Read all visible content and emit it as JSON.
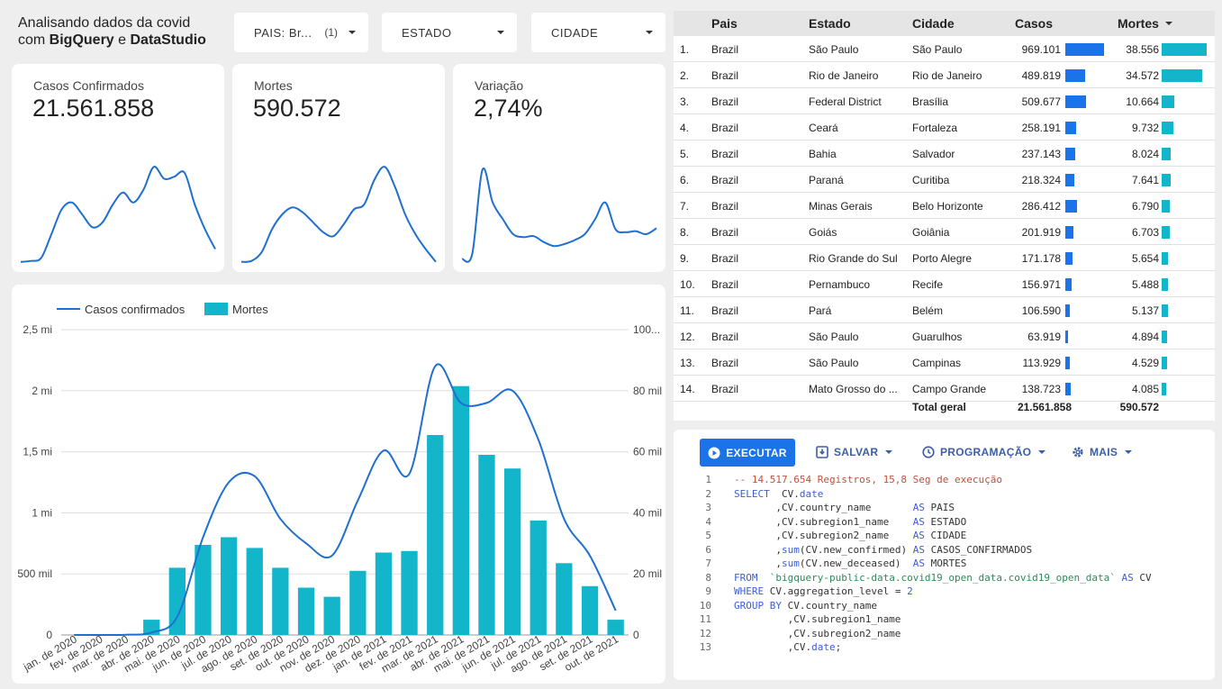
{
  "header": {
    "title_line1": "Analisando dados da covid",
    "title_prefix": "com ",
    "title_bigquery": "BigQuery",
    "title_e": " e ",
    "title_datastudio": "DataStudio"
  },
  "filters": [
    {
      "label": "PAIS: Br...",
      "count": "(1)"
    },
    {
      "label": "ESTADO",
      "count": ""
    },
    {
      "label": "CIDADE",
      "count": ""
    }
  ],
  "kpis": [
    {
      "label": "Casos Confirmados",
      "value": "21.561.858"
    },
    {
      "label": "Mortes",
      "value": "590.572"
    },
    {
      "label": "Variação",
      "value": "2,74%"
    }
  ],
  "colors": {
    "line": "#1f6fd1",
    "bar": "#12b5c9",
    "bar_cases": "#1a73e8",
    "bar_deaths": "#12b5c9"
  },
  "sparklines": [
    [
      0.02,
      0.03,
      0.06,
      0.3,
      0.55,
      0.62,
      0.5,
      0.37,
      0.42,
      0.6,
      0.72,
      0.62,
      0.75,
      0.98,
      0.86,
      0.88,
      0.92,
      0.6,
      0.35,
      0.15
    ],
    [
      0.02,
      0.03,
      0.12,
      0.35,
      0.5,
      0.57,
      0.52,
      0.42,
      0.32,
      0.28,
      0.4,
      0.55,
      0.6,
      0.85,
      0.98,
      0.78,
      0.5,
      0.3,
      0.15,
      0.02
    ],
    [
      0.05,
      0.1,
      0.95,
      0.62,
      0.45,
      0.3,
      0.27,
      0.28,
      0.22,
      0.18,
      0.2,
      0.24,
      0.3,
      0.45,
      0.62,
      0.35,
      0.32,
      0.33,
      0.3,
      0.36
    ]
  ],
  "chart_data": {
    "type": "bar",
    "legend": [
      "Casos confirmados",
      "Mortes"
    ],
    "legend_position": "top-left",
    "categories": [
      "jan. de 2020",
      "fev. de 2020",
      "mar. de 2020",
      "abr. de 2020",
      "mai. de 2020",
      "jun. de 2020",
      "jul. de 2020",
      "ago. de 2020",
      "set. de 2020",
      "out. de 2020",
      "nov. de 2020",
      "dez. de 2020",
      "jan. de 2021",
      "fev. de 2021",
      "mar. de 2021",
      "abr. de 2021",
      "mai. de 2021",
      "jun. de 2021",
      "jul. de 2021",
      "ago. de 2021",
      "set. de 2021",
      "out. de 2021"
    ],
    "series": [
      {
        "name": "Casos confirmados",
        "type": "line",
        "axis": "left",
        "values": [
          0,
          0,
          2000,
          20000,
          150000,
          800000,
          1250000,
          1300000,
          950000,
          750000,
          650000,
          1100000,
          1510000,
          1320000,
          2200000,
          1900000,
          1900000,
          2000000,
          1600000,
          950000,
          650000,
          200000
        ]
      },
      {
        "name": "Mortes",
        "type": "bar",
        "axis": "right",
        "values": [
          0,
          0,
          100,
          5000,
          22000,
          29500,
          32000,
          28500,
          22000,
          15500,
          12500,
          21000,
          27000,
          27500,
          65500,
          81500,
          59000,
          54500,
          37500,
          23500,
          16000,
          5000
        ]
      }
    ],
    "y_left": {
      "ticks": [
        "0",
        "500 mil",
        "1 mi",
        "1,5 mi",
        "2 mi",
        "2,5 mi"
      ],
      "range": [
        0,
        2500000
      ]
    },
    "y_right": {
      "ticks": [
        "0",
        "20 mil",
        "40 mil",
        "60 mil",
        "80 mil",
        "100..."
      ],
      "range": [
        0,
        100000
      ]
    },
    "grid": true
  },
  "table": {
    "headers": [
      "Pais",
      "Estado",
      "Cidade",
      "Casos",
      "Mortes"
    ],
    "sort_icon": "sort-desc-icon",
    "rows": [
      {
        "idx": "1.",
        "pais": "Brazil",
        "estado": "São Paulo",
        "cidade": "São Paulo",
        "casos": "969.101",
        "casos_n": 969101,
        "mortes": "38.556",
        "mortes_n": 38556
      },
      {
        "idx": "2.",
        "pais": "Brazil",
        "estado": "Rio de Janeiro",
        "cidade": "Rio de Janeiro",
        "casos": "489.819",
        "casos_n": 489819,
        "mortes": "34.572",
        "mortes_n": 34572
      },
      {
        "idx": "3.",
        "pais": "Brazil",
        "estado": "Federal District",
        "cidade": "Brasília",
        "casos": "509.677",
        "casos_n": 509677,
        "mortes": "10.664",
        "mortes_n": 10664
      },
      {
        "idx": "4.",
        "pais": "Brazil",
        "estado": "Ceará",
        "cidade": "Fortaleza",
        "casos": "258.191",
        "casos_n": 258191,
        "mortes": "9.732",
        "mortes_n": 9732
      },
      {
        "idx": "5.",
        "pais": "Brazil",
        "estado": "Bahia",
        "cidade": "Salvador",
        "casos": "237.143",
        "casos_n": 237143,
        "mortes": "8.024",
        "mortes_n": 8024
      },
      {
        "idx": "6.",
        "pais": "Brazil",
        "estado": "Paraná",
        "cidade": "Curitiba",
        "casos": "218.324",
        "casos_n": 218324,
        "mortes": "7.641",
        "mortes_n": 7641
      },
      {
        "idx": "7.",
        "pais": "Brazil",
        "estado": "Minas Gerais",
        "cidade": "Belo Horizonte",
        "casos": "286.412",
        "casos_n": 286412,
        "mortes": "6.790",
        "mortes_n": 6790
      },
      {
        "idx": "8.",
        "pais": "Brazil",
        "estado": "Goiás",
        "cidade": "Goiânia",
        "casos": "201.919",
        "casos_n": 201919,
        "mortes": "6.703",
        "mortes_n": 6703
      },
      {
        "idx": "9.",
        "pais": "Brazil",
        "estado": "Rio Grande do Sul",
        "cidade": "Porto Alegre",
        "casos": "171.178",
        "casos_n": 171178,
        "mortes": "5.654",
        "mortes_n": 5654
      },
      {
        "idx": "10.",
        "pais": "Brazil",
        "estado": "Pernambuco",
        "cidade": "Recife",
        "casos": "156.971",
        "casos_n": 156971,
        "mortes": "5.488",
        "mortes_n": 5488
      },
      {
        "idx": "11.",
        "pais": "Brazil",
        "estado": "Pará",
        "cidade": "Belém",
        "casos": "106.590",
        "casos_n": 106590,
        "mortes": "5.137",
        "mortes_n": 5137
      },
      {
        "idx": "12.",
        "pais": "Brazil",
        "estado": "São Paulo",
        "cidade": "Guarulhos",
        "casos": "63.919",
        "casos_n": 63919,
        "mortes": "4.894",
        "mortes_n": 4894
      },
      {
        "idx": "13.",
        "pais": "Brazil",
        "estado": "São Paulo",
        "cidade": "Campinas",
        "casos": "113.929",
        "casos_n": 113929,
        "mortes": "4.529",
        "mortes_n": 4529
      },
      {
        "idx": "14.",
        "pais": "Brazil",
        "estado": "Mato Grosso do ...",
        "cidade": "Campo Grande",
        "casos": "138.723",
        "casos_n": 138723,
        "mortes": "4.085",
        "mortes_n": 4085
      }
    ],
    "total_label": "Total geral",
    "total_casos": "21.561.858",
    "total_mortes": "590.572"
  },
  "sql_toolbar": {
    "run": "EXECUTAR",
    "save": "SALVAR",
    "schedule": "PROGRAMAÇÃO",
    "more": "MAIS"
  },
  "sql_lines": [
    {
      "n": "1",
      "html": "<span class=\"cm\">-- 14.517.654 Registros, 15,8 Seg de execução</span>"
    },
    {
      "n": "2",
      "html": "<span class=\"kw\">SELECT</span>  CV.<span class=\"fn\">date</span>"
    },
    {
      "n": "3",
      "html": "       ,CV.country_name       <span class=\"kw\">AS</span> PAIS"
    },
    {
      "n": "4",
      "html": "       ,CV.subregion1_name    <span class=\"kw\">AS</span> ESTADO"
    },
    {
      "n": "5",
      "html": "       ,CV.subregion2_name    <span class=\"kw\">AS</span> CIDADE"
    },
    {
      "n": "6",
      "html": "       ,<span class=\"fn\">sum</span>(CV.new_confirmed) <span class=\"kw\">AS</span> CASOS_CONFIRMADOS"
    },
    {
      "n": "7",
      "html": "       ,<span class=\"fn\">sum</span>(CV.new_deceased)  <span class=\"kw\">AS</span> MORTES"
    },
    {
      "n": "8",
      "html": "<span class=\"kw\">FROM</span>  <span class=\"st\">`bigquery-public-data.covid19_open_data.covid19_open_data`</span> <span class=\"kw\">AS</span> CV"
    },
    {
      "n": "9",
      "html": "<span class=\"kw\">WHERE</span> CV.aggregation_level = <span class=\"kw\">2</span>"
    },
    {
      "n": "10",
      "html": "<span class=\"kw\">GROUP BY</span> CV.country_name"
    },
    {
      "n": "11",
      "html": "         ,CV.subregion1_name"
    },
    {
      "n": "12",
      "html": "         ,CV.subregion2_name"
    },
    {
      "n": "13",
      "html": "         ,CV.<span class=\"fn\">date</span>;"
    }
  ]
}
